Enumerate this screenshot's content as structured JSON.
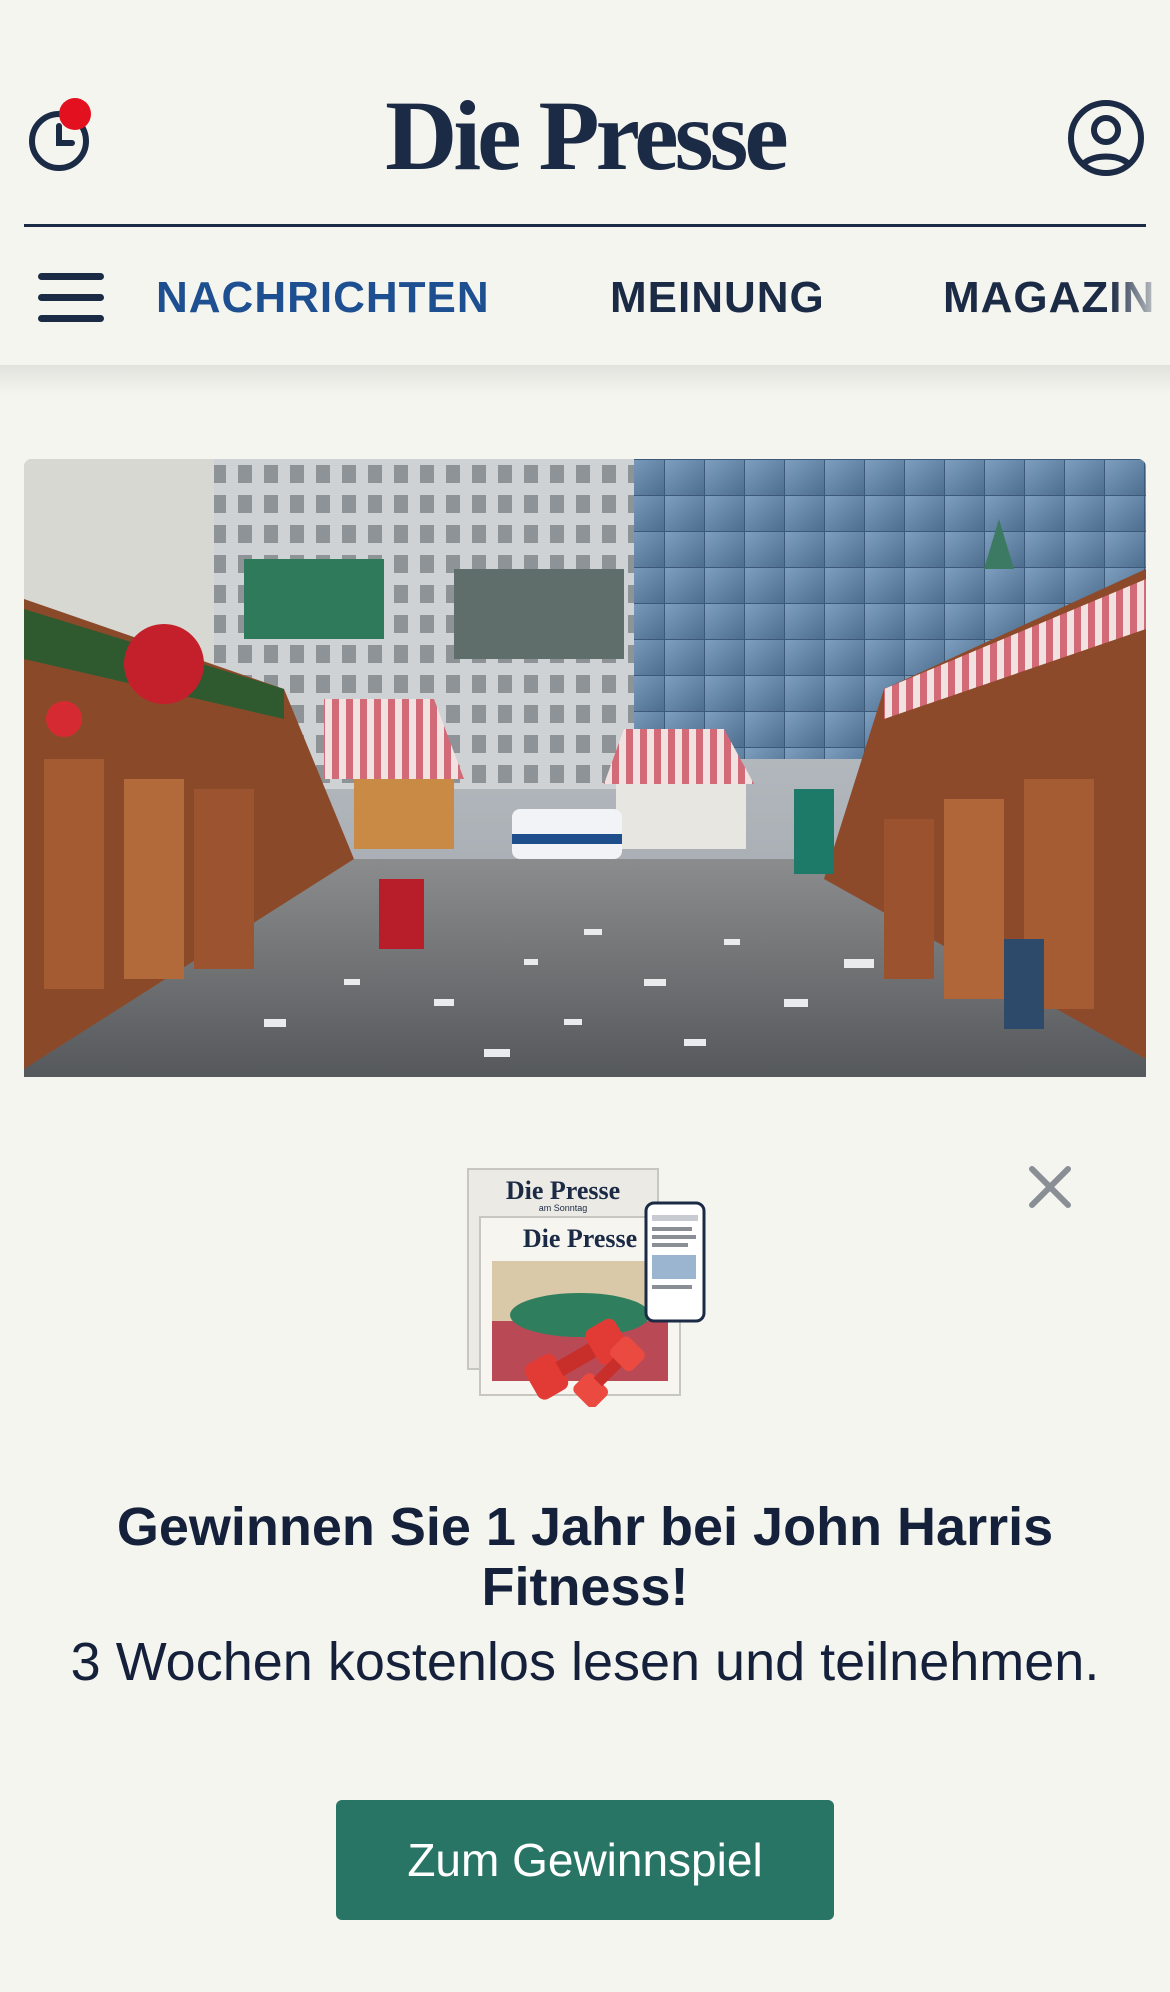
{
  "header": {
    "logo": "Die Presse",
    "history_icon": "clock-history-icon",
    "account_icon": "user-account-icon"
  },
  "nav": {
    "menu_icon": "hamburger-menu-icon",
    "items": [
      {
        "label": "NACHRICHTEN",
        "active": true
      },
      {
        "label": "MEINUNG",
        "active": false
      },
      {
        "label": "MAGAZIN",
        "active": false
      }
    ]
  },
  "hero": {
    "image": "christmas-market-photo"
  },
  "promo": {
    "image_logo_1": "Die Presse",
    "image_logo_1_sub": "am Sonntag",
    "image_logo_2": "Die Presse",
    "title": "Gewinnen Sie 1 Jahr bei John Harris Fitness!",
    "subtitle": "3 Wochen kostenlos lesen und teilnehmen.",
    "cta_label": "Zum Gewinnspiel",
    "close_icon": "close-icon"
  },
  "colors": {
    "brand_navy": "#1b2a45",
    "nav_active": "#1d4f91",
    "notification_dot": "#e3101f",
    "cta_green": "#287565",
    "background": "#f5f5f0"
  }
}
